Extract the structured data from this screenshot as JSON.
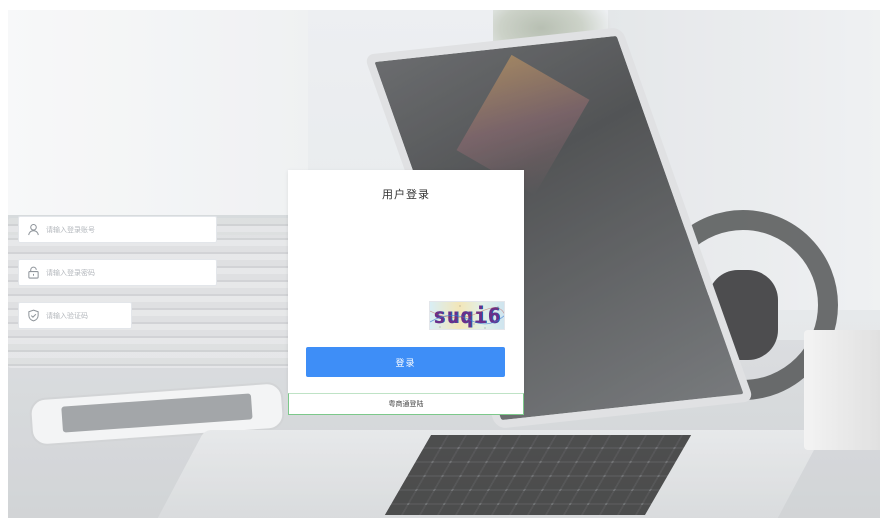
{
  "login": {
    "title": "用户登录",
    "username_placeholder": "请输入登录账号",
    "password_placeholder": "请输入登录密码",
    "captcha_placeholder": "请输入验证码",
    "captcha_text": "suqi6",
    "submit_label": "登录",
    "alt_login_label": "粤商通登陆"
  },
  "icons": {
    "username": "user-icon",
    "password": "lock-icon",
    "captcha": "shield-check-icon"
  },
  "colors": {
    "primary_button": "#3e8ef7",
    "alt_login_border": "#7cc88a",
    "input_border": "#e3e6ea",
    "placeholder": "#b3b7bc"
  }
}
